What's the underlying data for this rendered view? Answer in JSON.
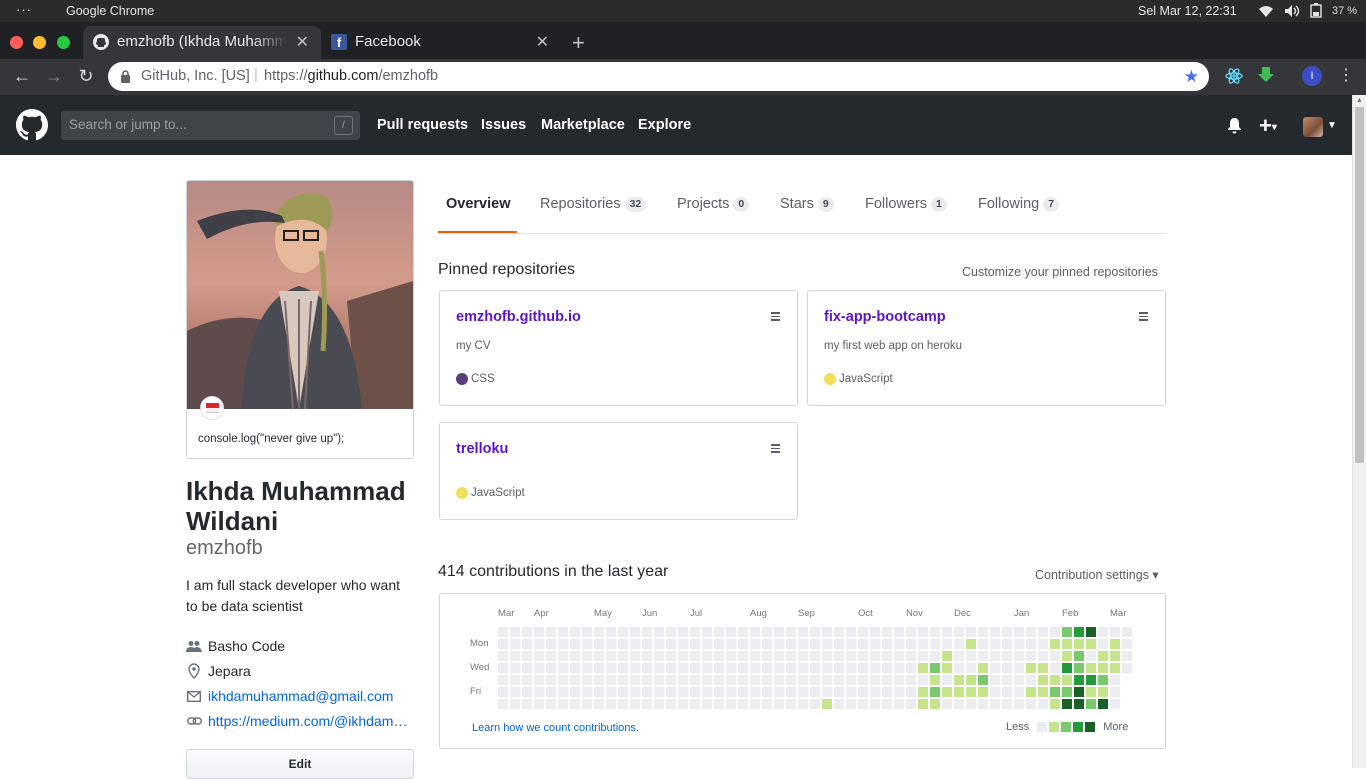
{
  "os": {
    "app_name": "Google Chrome",
    "datetime": "Sel Mar 12, 22:31",
    "battery": "37 %"
  },
  "browser": {
    "tabs": [
      {
        "title": "emzhofb (Ikhda Muhammad Wildani)",
        "icon": "github-icon"
      },
      {
        "title": "Facebook",
        "icon": "facebook-icon"
      }
    ],
    "site_identity": "GitHub, Inc. [US]",
    "url_scheme": "https://",
    "url_host": "github.com",
    "url_path": "/emzhofb",
    "profile_initial": "I"
  },
  "github_header": {
    "search_placeholder": "Search or jump to...",
    "search_shortcut": "/",
    "nav": [
      "Pull requests",
      "Issues",
      "Marketplace",
      "Explore"
    ]
  },
  "profile": {
    "status": "console.log(\"never give up\");",
    "name_line1": "Ikhda Muhammad",
    "name_line2": "Wildani",
    "username": "emzhofb",
    "bio": "I am full stack developer who want to be data scientist",
    "company": "Basho Code",
    "location": "Jepara",
    "email": "ikhdamuhammad@gmail.com",
    "website": "https://medium.com/@ikhdamuhammad",
    "edit_label": "Edit"
  },
  "profile_tabs": [
    {
      "label": "Overview",
      "count": null
    },
    {
      "label": "Repositories",
      "count": "32"
    },
    {
      "label": "Projects",
      "count": "0"
    },
    {
      "label": "Stars",
      "count": "9"
    },
    {
      "label": "Followers",
      "count": "1"
    },
    {
      "label": "Following",
      "count": "7"
    }
  ],
  "pinned": {
    "title": "Pinned repositories",
    "customize": "Customize your pinned repositories",
    "repos": [
      {
        "name": "emzhofb.github.io",
        "desc": "my CV",
        "lang": "CSS",
        "color": "#563d7c"
      },
      {
        "name": "fix-app-bootcamp",
        "desc": "my first web app on heroku",
        "lang": "JavaScript",
        "color": "#f1e05a"
      },
      {
        "name": "trelloku",
        "desc": "",
        "lang": "JavaScript",
        "color": "#f1e05a"
      }
    ]
  },
  "contributions": {
    "title": "414 contributions in the last year",
    "settings": "Contribution settings ▾",
    "months": [
      "Mar",
      "Apr",
      "May",
      "Jun",
      "Jul",
      "Aug",
      "Sep",
      "Oct",
      "Nov",
      "Dec",
      "Jan",
      "Feb",
      "Mar"
    ],
    "days": [
      "Mon",
      "Wed",
      "Fri"
    ],
    "learn": "Learn how we count contributions.",
    "less": "Less",
    "more": "More",
    "palette": [
      "#ebedf0",
      "#c6e48b",
      "#7bc96f",
      "#239a3b",
      "#196127"
    ]
  }
}
